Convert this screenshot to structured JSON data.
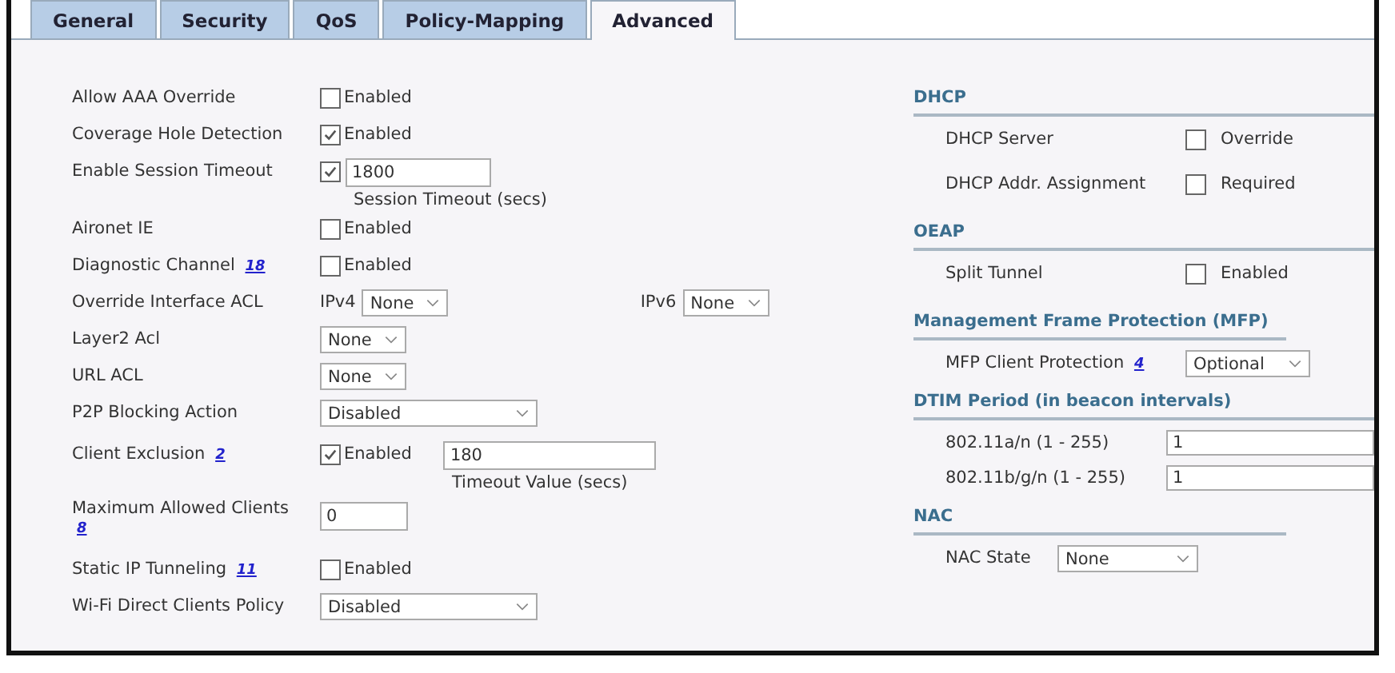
{
  "tabs": [
    {
      "label": "General",
      "selected": false
    },
    {
      "label": "Security",
      "selected": false
    },
    {
      "label": "QoS",
      "selected": false
    },
    {
      "label": "Policy-Mapping",
      "selected": false
    },
    {
      "label": "Advanced",
      "selected": true
    }
  ],
  "left": [
    {
      "kind": "checkbox",
      "label": "Allow AAA Override",
      "checked": false,
      "option": "Enabled"
    },
    {
      "kind": "checkbox",
      "label": "Coverage Hole Detection",
      "checked": true,
      "option": "Enabled"
    },
    {
      "kind": "timeout",
      "label": "Enable Session Timeout",
      "checked": true,
      "value": "1800",
      "caption": "Session Timeout (secs)"
    },
    {
      "kind": "checkbox",
      "label": "Aironet IE",
      "checked": false,
      "option": "Enabled"
    },
    {
      "kind": "checkbox",
      "label": "Diagnostic Channel",
      "footnote": "18",
      "checked": false,
      "option": "Enabled"
    },
    {
      "kind": "acl",
      "label": "Override Interface ACL",
      "ipv4_label": "IPv4",
      "ipv4_value": "None",
      "ipv6_label": "IPv6",
      "ipv6_value": "None"
    },
    {
      "kind": "select",
      "label": "Layer2 Acl",
      "value": "None"
    },
    {
      "kind": "select",
      "label": "URL ACL",
      "value": "None"
    },
    {
      "kind": "wide_select",
      "label": "P2P Blocking Action",
      "value": "Disabled"
    },
    {
      "kind": "exclusion",
      "label": "Client Exclusion",
      "footnote": "2",
      "checked": true,
      "option": "Enabled",
      "value": "180",
      "caption": "Timeout Value (secs)"
    },
    {
      "kind": "input",
      "label": "Maximum Allowed Clients",
      "footnote": "8",
      "value": "0"
    },
    {
      "kind": "checkbox",
      "label": "Static IP Tunneling",
      "footnote": "11",
      "checked": false,
      "option": "Enabled"
    },
    {
      "kind": "wide_select",
      "label": "Wi-Fi Direct Clients Policy",
      "value": "Disabled"
    }
  ],
  "right": [
    {
      "title": "DHCP",
      "rows": [
        {
          "kind": "checkbox",
          "label": "DHCP Server",
          "checked": false,
          "option": "Override"
        },
        {
          "kind": "checkbox",
          "label": "DHCP Addr. Assignment",
          "checked": false,
          "option": "Required"
        }
      ]
    },
    {
      "title": "OEAP",
      "rows": [
        {
          "kind": "checkbox",
          "label": "Split Tunnel",
          "checked": false,
          "option": "Enabled"
        }
      ]
    },
    {
      "title": "Management Frame Protection (MFP)",
      "rows": [
        {
          "kind": "select",
          "label": "MFP Client Protection",
          "footnote": "4",
          "value": "Optional"
        }
      ]
    },
    {
      "title": "DTIM Period (in beacon intervals)",
      "rows": [
        {
          "kind": "input",
          "label": "802.11a/n (1 - 255)",
          "value": "1"
        },
        {
          "kind": "input",
          "label": "802.11b/g/n (1 - 255)",
          "value": "1"
        }
      ]
    },
    {
      "title": "NAC",
      "rows": [
        {
          "kind": "select",
          "label": "NAC State",
          "value": "None"
        }
      ]
    }
  ]
}
